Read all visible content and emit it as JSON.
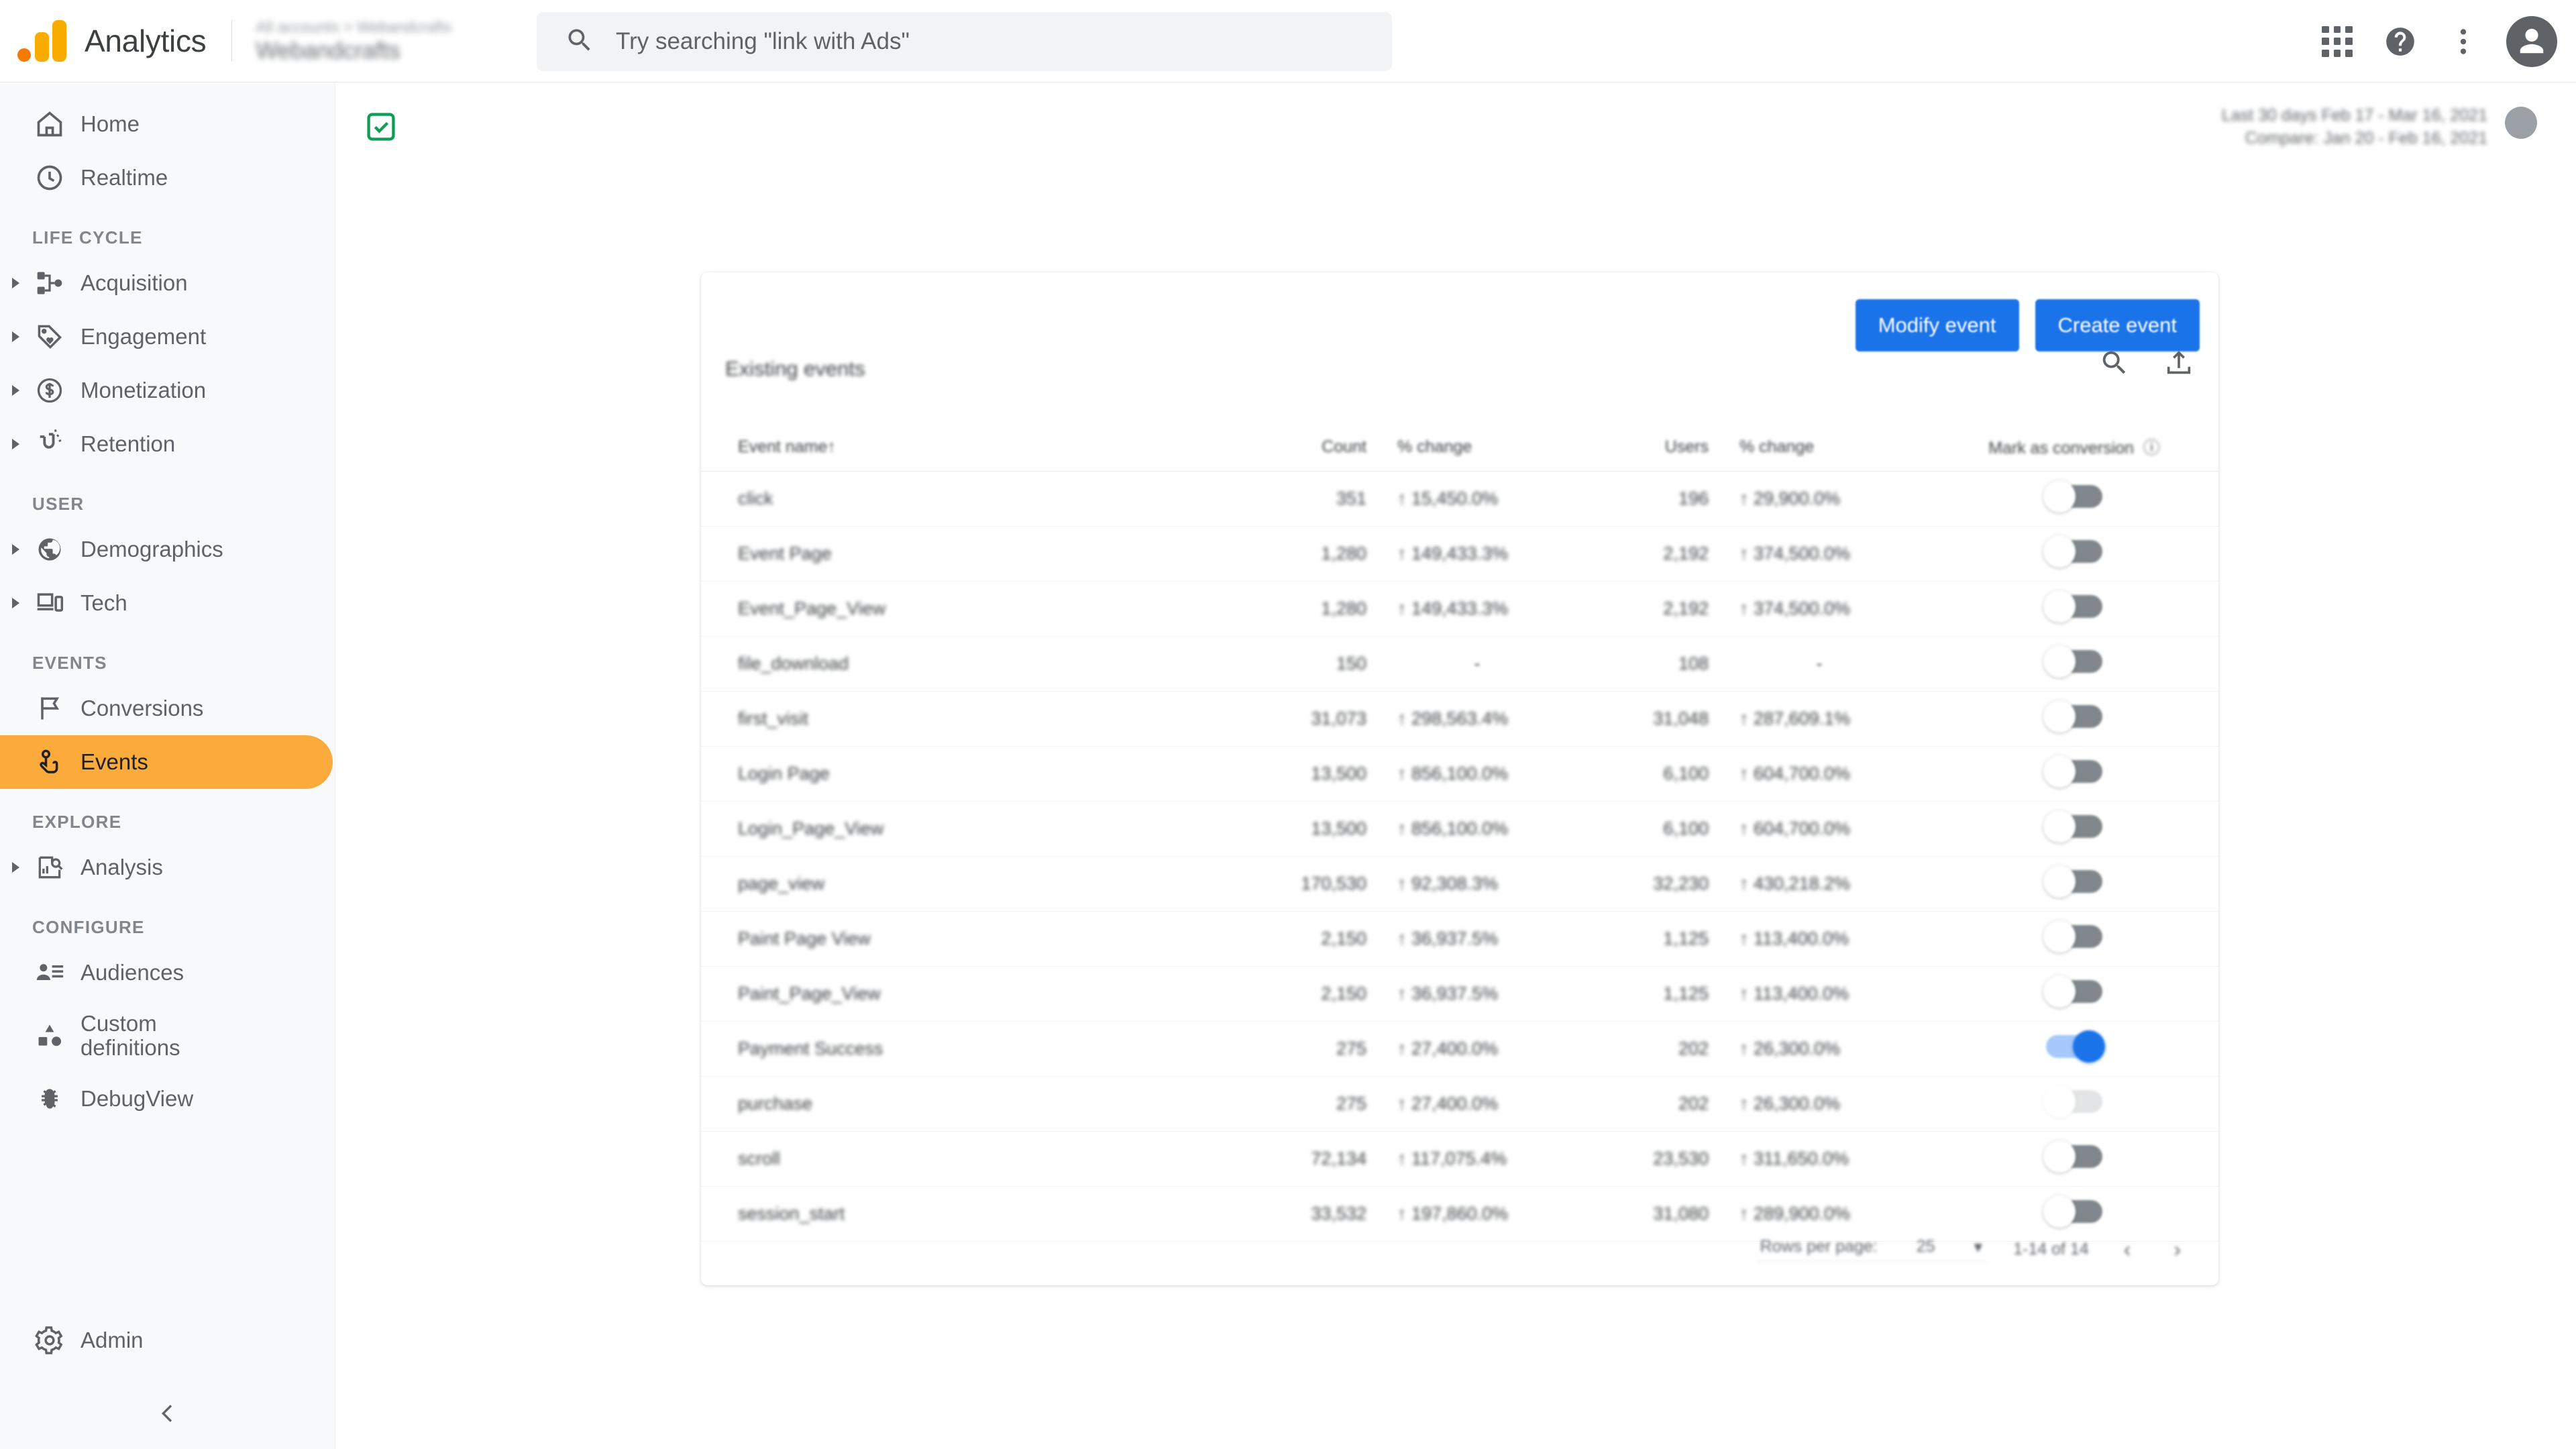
{
  "topbar": {
    "brand": "Analytics",
    "account_path": "All accounts > Webandcrafts",
    "property_name": "Webandcrafts",
    "logo_icon": "google-analytics-logo",
    "search": {
      "placeholder": "Try searching \"link with Ads\"",
      "value": "",
      "icon": "search-icon"
    },
    "apps_icon": "apps-grid-icon",
    "help_icon": "help-circle-icon",
    "more_icon": "more-vert-icon",
    "avatar_icon": "user-avatar-icon"
  },
  "sidebar": {
    "top_items": [
      {
        "label": "Home",
        "icon": "home-icon",
        "name": "home"
      },
      {
        "label": "Realtime",
        "icon": "clock-icon",
        "name": "realtime"
      }
    ],
    "sections": [
      {
        "title": "LIFE CYCLE",
        "items": [
          {
            "label": "Acquisition",
            "icon": "acquisition-node-icon",
            "name": "acquisition",
            "expandable": true
          },
          {
            "label": "Engagement",
            "icon": "tag-heart-icon",
            "name": "engagement",
            "expandable": true
          },
          {
            "label": "Monetization",
            "icon": "dollar-circle-icon",
            "name": "monetization",
            "expandable": true
          },
          {
            "label": "Retention",
            "icon": "magnet-icon",
            "name": "retention",
            "expandable": true
          }
        ]
      },
      {
        "title": "USER",
        "items": [
          {
            "label": "Demographics",
            "icon": "globe-icon",
            "name": "demographics",
            "expandable": true
          },
          {
            "label": "Tech",
            "icon": "devices-icon",
            "name": "tech",
            "expandable": true
          }
        ]
      },
      {
        "title": "EVENTS",
        "items": [
          {
            "label": "Conversions",
            "icon": "flag-icon",
            "name": "conversions",
            "expandable": false
          },
          {
            "label": "Events",
            "icon": "tap-finger-icon",
            "name": "events",
            "expandable": false,
            "active": true
          }
        ]
      },
      {
        "title": "EXPLORE",
        "items": [
          {
            "label": "Analysis",
            "icon": "analysis-chart-search-icon",
            "name": "analysis",
            "expandable": true
          }
        ]
      },
      {
        "title": "CONFIGURE",
        "items": [
          {
            "label": "Audiences",
            "icon": "audience-person-list-icon",
            "name": "audiences",
            "expandable": false
          },
          {
            "label": "Custom definitions",
            "label_line1": "Custom",
            "label_line2": "definitions",
            "icon": "shapes-icon",
            "name": "custom-definitions",
            "expandable": false
          },
          {
            "label": "DebugView",
            "icon": "bug-icon",
            "name": "debugview",
            "expandable": false
          }
        ]
      }
    ],
    "admin": {
      "label": "Admin",
      "icon": "gear-icon"
    },
    "collapse_icon": "chevron-left-icon"
  },
  "main": {
    "date_range": "Last 30 days  Feb 17 - Mar 16, 2021",
    "compare_range": "Compare: Jan 20 - Feb 16, 2021",
    "verified_icon": "check-badge-icon",
    "user_avatar_icon": "user-avatar-icon"
  },
  "card": {
    "modify_event_label": "Modify event",
    "create_event_label": "Create event",
    "subheading": "Existing events",
    "search_icon": "search-icon",
    "share_icon": "share-export-icon",
    "columns": [
      {
        "key": "event_name",
        "label": "Event name",
        "sort": "↑"
      },
      {
        "key": "count",
        "label": "Count"
      },
      {
        "key": "count_change",
        "label": "% change"
      },
      {
        "key": "users",
        "label": "Users"
      },
      {
        "key": "users_change",
        "label": "% change"
      },
      {
        "key": "conversion",
        "label": "Mark as conversion",
        "info_icon": "info-icon"
      }
    ],
    "rows": [
      {
        "event_name": "click",
        "count": "351",
        "count_change": "↑ 15,450.0%",
        "users": "196",
        "users_change": "↑ 29,900.0%",
        "conversion": false
      },
      {
        "event_name": "Event Page",
        "count": "1,280",
        "count_change": "↑ 149,433.3%",
        "users": "2,192",
        "users_change": "↑ 374,500.0%",
        "conversion": false
      },
      {
        "event_name": "Event_Page_View",
        "count": "1,280",
        "count_change": "↑ 149,433.3%",
        "users": "2,192",
        "users_change": "↑ 374,500.0%",
        "conversion": false
      },
      {
        "event_name": "file_download",
        "count": "150",
        "count_change": "-",
        "users": "108",
        "users_change": "-",
        "conversion": false
      },
      {
        "event_name": "first_visit",
        "count": "31,073",
        "count_change": "↑ 298,563.4%",
        "users": "31,048",
        "users_change": "↑ 287,609.1%",
        "conversion": false
      },
      {
        "event_name": "Login Page",
        "count": "13,500",
        "count_change": "↑ 856,100.0%",
        "users": "6,100",
        "users_change": "↑ 604,700.0%",
        "conversion": false
      },
      {
        "event_name": "Login_Page_View",
        "count": "13,500",
        "count_change": "↑ 856,100.0%",
        "users": "6,100",
        "users_change": "↑ 604,700.0%",
        "conversion": false
      },
      {
        "event_name": "page_view",
        "count": "170,530",
        "count_change": "↑ 92,308.3%",
        "users": "32,230",
        "users_change": "↑ 430,218.2%",
        "conversion": false
      },
      {
        "event_name": "Paint Page View",
        "count": "2,150",
        "count_change": "↑ 36,937.5%",
        "users": "1,125",
        "users_change": "↑ 113,400.0%",
        "conversion": false
      },
      {
        "event_name": "Paint_Page_View",
        "count": "2,150",
        "count_change": "↑ 36,937.5%",
        "users": "1,125",
        "users_change": "↑ 113,400.0%",
        "conversion": false
      },
      {
        "event_name": "Payment Success",
        "count": "275",
        "count_change": "↑ 27,400.0%",
        "users": "202",
        "users_change": "↑ 26,300.0%",
        "conversion": true
      },
      {
        "event_name": "purchase",
        "count": "275",
        "count_change": "↑ 27,400.0%",
        "users": "202",
        "users_change": "↑ 26,300.0%",
        "conversion": false,
        "disabled": true
      },
      {
        "event_name": "scroll",
        "count": "72,134",
        "count_change": "↑ 117,075.4%",
        "users": "23,530",
        "users_change": "↑ 311,650.0%",
        "conversion": false
      },
      {
        "event_name": "session_start",
        "count": "33,532",
        "count_change": "↑ 197,860.0%",
        "users": "31,080",
        "users_change": "↑ 289,900.0%",
        "conversion": false
      }
    ],
    "pagination": {
      "rows_per_page_label": "Rows per page:",
      "rows_per_page_value": "25",
      "range_label": "1-14 of 14",
      "prev_icon": "chevron-left-icon",
      "next_icon": "chevron-right-icon"
    }
  },
  "colors": {
    "brand_orange": "#f9ab00",
    "accent_blue": "#1a73e8",
    "positive_green": "#137333",
    "active_nav": "#fbab3b"
  }
}
